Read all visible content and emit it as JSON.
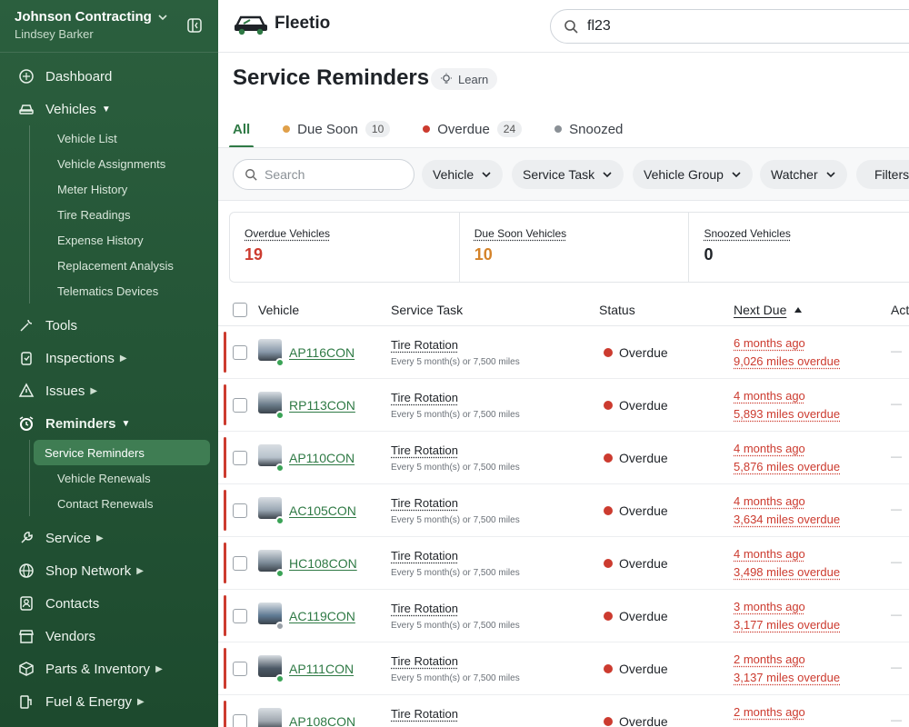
{
  "sidebar": {
    "org_name": "Johnson Contracting",
    "user_name": "Lindsey Barker",
    "nav": [
      {
        "label": "Dashboard",
        "icon": "dashboard-icon"
      },
      {
        "label": "Vehicles",
        "icon": "car-icon",
        "expanded": true,
        "children": [
          "Vehicle List",
          "Vehicle Assignments",
          "Meter History",
          "Tire Readings",
          "Expense History",
          "Replacement Analysis",
          "Telematics Devices"
        ]
      },
      {
        "label": "Tools",
        "icon": "tools-icon"
      },
      {
        "label": "Inspections",
        "icon": "clipboard-icon",
        "has_children": true
      },
      {
        "label": "Issues",
        "icon": "warning-icon",
        "has_children": true
      },
      {
        "label": "Reminders",
        "icon": "alarm-icon",
        "expanded": true,
        "children": [
          "Service Reminders",
          "Vehicle Renewals",
          "Contact Renewals"
        ]
      },
      {
        "label": "Service",
        "icon": "wrench-icon",
        "has_children": true
      },
      {
        "label": "Shop Network",
        "icon": "globe-icon",
        "has_children": true
      },
      {
        "label": "Contacts",
        "icon": "contacts-icon"
      },
      {
        "label": "Vendors",
        "icon": "store-icon"
      },
      {
        "label": "Parts & Inventory",
        "icon": "box-icon",
        "has_children": true
      },
      {
        "label": "Fuel & Energy",
        "icon": "fuel-icon",
        "has_children": true
      }
    ],
    "active_sub": "Service Reminders"
  },
  "header": {
    "logo_text": "Fleetio",
    "search_value": "fl23"
  },
  "page": {
    "title": "Service Reminders",
    "learn_label": "Learn"
  },
  "tabs": [
    {
      "label": "All",
      "active": true
    },
    {
      "label": "Due Soon",
      "count": "10",
      "dot_color": "#e0a04a"
    },
    {
      "label": "Overdue",
      "count": "24",
      "dot_color": "#cc3b2f"
    },
    {
      "label": "Snoozed",
      "dot_color": "#8a9096"
    }
  ],
  "filters": {
    "search_placeholder": "Search",
    "chips": [
      "Vehicle",
      "Service Task",
      "Vehicle Group",
      "Watcher",
      "Filters"
    ]
  },
  "stats": [
    {
      "label": "Overdue Vehicles",
      "value": "19",
      "color": "#cc3b2f"
    },
    {
      "label": "Due Soon Vehicles",
      "value": "10",
      "color": "#d4832a"
    },
    {
      "label": "Snoozed Vehicles",
      "value": "0",
      "color": "#1f2328"
    }
  ],
  "table": {
    "columns": [
      "Vehicle",
      "Service Task",
      "Status",
      "Next Due",
      "Actions"
    ],
    "rows": [
      {
        "vehicle": "AP116CON",
        "task": "Tire Rotation",
        "interval": "Every 5 month(s) or 7,500 miles",
        "status": "Overdue",
        "due_time": "6 months ago",
        "due_miles": "9,026 miles overdue",
        "online": true
      },
      {
        "vehicle": "RP113CON",
        "task": "Tire Rotation",
        "interval": "Every 5 month(s) or 7,500 miles",
        "status": "Overdue",
        "due_time": "4 months ago",
        "due_miles": "5,893 miles overdue",
        "online": true
      },
      {
        "vehicle": "AP110CON",
        "task": "Tire Rotation",
        "interval": "Every 5 month(s) or 7,500 miles",
        "status": "Overdue",
        "due_time": "4 months ago",
        "due_miles": "5,876 miles overdue",
        "online": true
      },
      {
        "vehicle": "AC105CON",
        "task": "Tire Rotation",
        "interval": "Every 5 month(s) or 7,500 miles",
        "status": "Overdue",
        "due_time": "4 months ago",
        "due_miles": "3,634 miles overdue",
        "online": true
      },
      {
        "vehicle": "HC108CON",
        "task": "Tire Rotation",
        "interval": "Every 5 month(s) or 7,500 miles",
        "status": "Overdue",
        "due_time": "4 months ago",
        "due_miles": "3,498 miles overdue",
        "online": true
      },
      {
        "vehicle": "AC119CON",
        "task": "Tire Rotation",
        "interval": "Every 5 month(s) or 7,500 miles",
        "status": "Overdue",
        "due_time": "3 months ago",
        "due_miles": "3,177 miles overdue",
        "online": false
      },
      {
        "vehicle": "AP111CON",
        "task": "Tire Rotation",
        "interval": "Every 5 month(s) or 7,500 miles",
        "status": "Overdue",
        "due_time": "2 months ago",
        "due_miles": "3,137 miles overdue",
        "online": true
      },
      {
        "vehicle": "AP108CON",
        "task": "Tire Rotation",
        "interval": "",
        "status": "Overdue",
        "due_time": "2 months ago",
        "due_miles": "",
        "online": true
      }
    ]
  },
  "colors": {
    "brand_green": "#2f7a45",
    "overdue_red": "#cc3b2f",
    "due_soon_orange": "#d4832a"
  }
}
